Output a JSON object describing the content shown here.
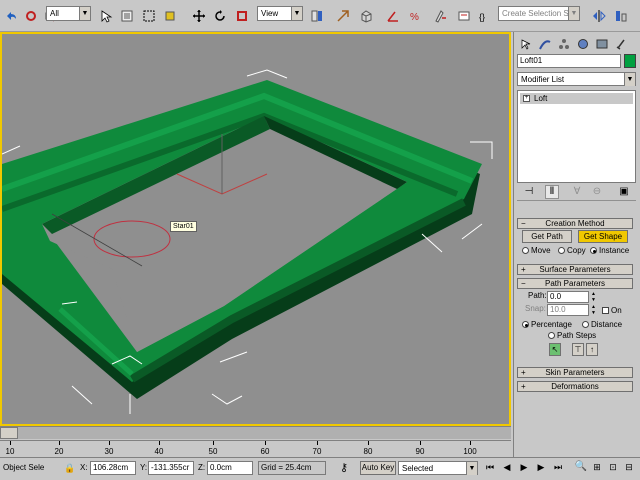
{
  "toolbar": {
    "selection_filter": "All",
    "reference_coord": "View",
    "named_selection_placeholder": "Create Selection Set",
    "icons": [
      "undo-icon",
      "redo-icon",
      "select-link-icon",
      "unlink-icon",
      "bind-spacewarp-icon",
      "selection-filter",
      "select-object-icon",
      "select-by-name-icon",
      "rect-selection-icon",
      "window-crossing-icon",
      "move-icon",
      "rotate-icon",
      "scale-icon",
      "reference-coord",
      "pivot-center-icon",
      "select-manipulate-icon",
      "snap-3d-icon",
      "angle-snap-icon",
      "percent-snap-icon",
      "spinner-snap-icon",
      "named-selection",
      "mirror-icon",
      "align-icon"
    ]
  },
  "viewport": {
    "object_label": "Star01",
    "colors": {
      "loft_green": "#0f8a3c",
      "loft_dark": "#0a5a26",
      "loft_shadow": "#063d19",
      "bg": "#8f8f8f",
      "active_border": "#f0c800"
    }
  },
  "timeline": {
    "slider_label": "0 / 100"
  },
  "ruler": {
    "ticks": [
      "10",
      "20",
      "30",
      "40",
      "50",
      "60",
      "70",
      "80",
      "90",
      "100"
    ]
  },
  "status": {
    "selection_mode": "Object Sele",
    "x_label": "X:",
    "x_value": "106.28cm",
    "y_label": "Y:",
    "y_value": "-131.355cr",
    "z_label": "Z:",
    "z_value": "0.0cm",
    "grid": "Grid = 25.4cm",
    "auto_key": "Auto Key",
    "key_filter": "Selected"
  },
  "command_panel": {
    "object_name": "Loft01",
    "object_color": "#00a040",
    "modifier_list": "Modifier List",
    "stack_item": "Loft",
    "creation_method": {
      "title": "Creation Method",
      "get_path": "Get Path",
      "get_shape": "Get Shape",
      "move": "Move",
      "copy": "Copy",
      "instance": "Instance"
    },
    "surface_parameters": "Surface Parameters",
    "path_parameters": {
      "title": "Path Parameters",
      "path_label": "Path:",
      "path_value": "0.0",
      "snap_label": "Snap:",
      "snap_value": "10.0",
      "on_label": "On",
      "percentage": "Percentage",
      "distance": "Distance",
      "path_steps": "Path Steps"
    },
    "skin_parameters": "Skin Parameters",
    "deformations": "Deformations"
  }
}
